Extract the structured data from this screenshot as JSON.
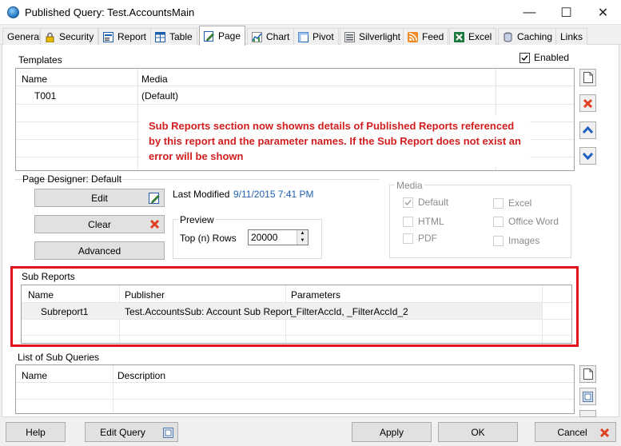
{
  "window": {
    "title": "Published Query: Test.AccountsMain",
    "minimize": "—",
    "maximize": "☐",
    "close": "✕"
  },
  "tabs": [
    {
      "label": "General",
      "icon": "none"
    },
    {
      "label": "Security",
      "icon": "lock-icon"
    },
    {
      "label": "Report",
      "icon": "report-icon"
    },
    {
      "label": "Table",
      "icon": "table-icon"
    },
    {
      "label": "Page",
      "icon": "page-edit-icon",
      "active": true
    },
    {
      "label": "Chart",
      "icon": "chart-icon"
    },
    {
      "label": "Pivot",
      "icon": "pivot-icon"
    },
    {
      "label": "Silverlight",
      "icon": "silverlight-icon"
    },
    {
      "label": "Feed",
      "icon": "rss-icon"
    },
    {
      "label": "Excel",
      "icon": "excel-icon"
    },
    {
      "label": "Caching",
      "icon": "database-icon"
    },
    {
      "label": "Links",
      "icon": "none"
    }
  ],
  "templates": {
    "label": "Templates",
    "enabled_label": "Enabled",
    "enabled": true,
    "columns": [
      "Name",
      "Media"
    ],
    "rows": [
      {
        "name": "T001",
        "media": "(Default)"
      }
    ]
  },
  "annotation": "Sub Reports section  now showns details of Published Reports referenced by this report and the parameter names.  If the Sub Report does not exist an error will be shown",
  "page_designer": {
    "label": "Page Designer: Default",
    "edit_label": "Edit",
    "clear_label": "Clear",
    "advanced_label": "Advanced",
    "last_modified_label": "Last Modified",
    "last_modified_value": "9/11/2015 7:41 PM",
    "preview_label": "Preview",
    "top_rows_label": "Top (n) Rows",
    "top_rows_value": "20000"
  },
  "media": {
    "label": "Media",
    "options": [
      {
        "label": "Default",
        "checked": true
      },
      {
        "label": "Excel",
        "checked": false
      },
      {
        "label": "HTML",
        "checked": false
      },
      {
        "label": "Office Word",
        "checked": false
      },
      {
        "label": "PDF",
        "checked": false
      },
      {
        "label": "Images",
        "checked": false
      }
    ]
  },
  "sub_reports": {
    "label": "Sub Reports",
    "columns": [
      "Name",
      "Publisher",
      "Parameters"
    ],
    "rows": [
      {
        "name": "Subreport1",
        "publisher": "Test.AccountsSub: Account Sub Report",
        "parameters": "_FilterAccId, _FilterAccId_2"
      }
    ]
  },
  "sub_queries": {
    "label": "List of Sub Queries",
    "columns": [
      "Name",
      "Description"
    ]
  },
  "footer": {
    "help_label": "Help",
    "edit_query_label": "Edit Query",
    "apply_label": "Apply",
    "ok_label": "OK",
    "cancel_label": "Cancel"
  },
  "colors": {
    "annotation_red": "#d21e1e",
    "highlight_box": "#e0141b",
    "accent_blue": "#1f5fb0"
  }
}
